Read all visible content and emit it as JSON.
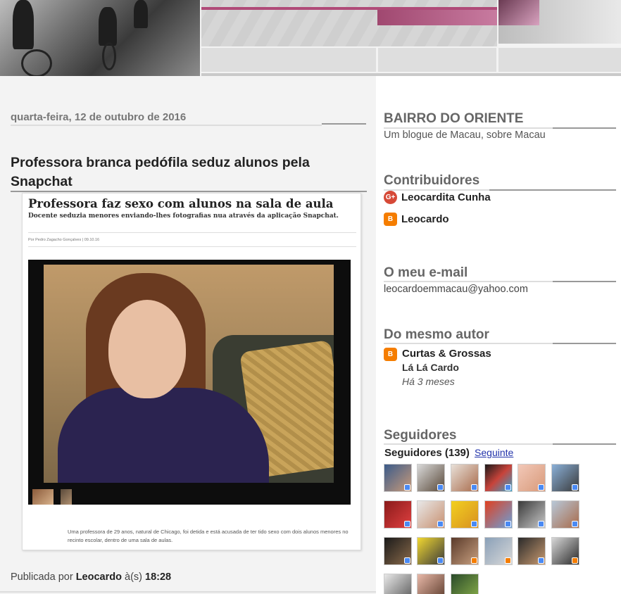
{
  "post": {
    "date": "quarta-feira, 12 de outubro de 2016",
    "title": "Professora branca pedófila seduz alunos pela Snapchat",
    "clipping": {
      "headline": "Professora faz sexo com alunos na sala de aula",
      "subheadline": "Docente seduzia menores enviando-lhes fotografias nua através da aplicação Snapchat.",
      "byline": "Por Pedro Zagacho Gonçalves | 09.10.16",
      "caption": "Uma professora de 29 anos, natural de Chicago, foi detida e está acusada de ter tido sexo com dois alunos menores no recinto escolar, dentro de uma sala de aulas."
    },
    "footer": {
      "published_by": "Publicada por",
      "author": "Leocardo",
      "at": "à(s)",
      "time": "18:28"
    }
  },
  "sidebar": {
    "blog": {
      "title": "BAIRRO DO ORIENTE",
      "description": "Um blogue de Macau, sobre Macau"
    },
    "contributors": {
      "title": "Contribuidores",
      "items": [
        {
          "name": "Leocardita Cunha",
          "icon": "google-plus-icon"
        },
        {
          "name": "Leocardo",
          "icon": "blogger-icon"
        }
      ]
    },
    "email": {
      "title": "O meu e-mail",
      "address": "leocardoemmacau@yahoo.com"
    },
    "same_author": {
      "title": "Do mesmo autor",
      "blog_name": "Curtas & Grossas",
      "post_title": "Lá Lá Cardo",
      "time_ago": "Há 3 meses"
    },
    "followers": {
      "title": "Seguidores",
      "count_label": "Seguidores (139)",
      "follow_link": "Seguinte"
    }
  },
  "colors": {
    "accent_pink": "#b04a78",
    "link_blue": "#2233aa",
    "google_plus": "#d64937",
    "blogger": "#f57d00"
  }
}
